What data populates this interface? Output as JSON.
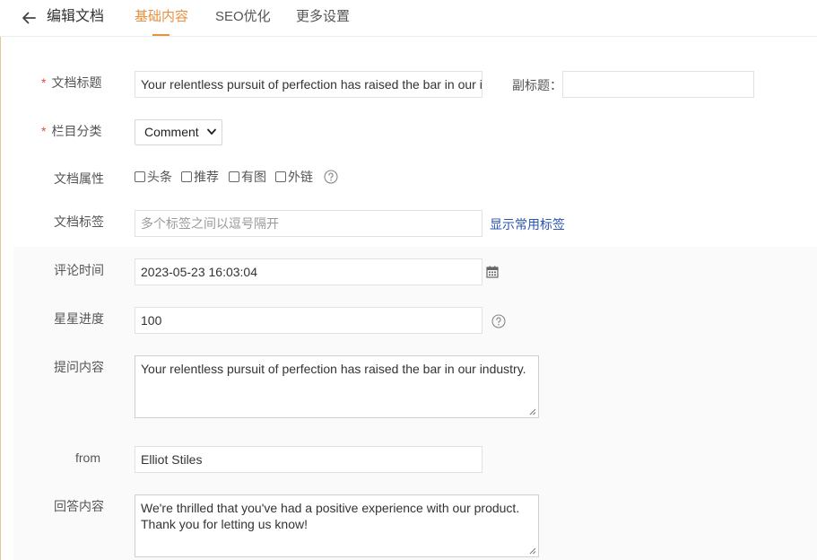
{
  "header": {
    "back_icon": "arrow-left-icon",
    "title": "编辑文档",
    "tabs": [
      {
        "label": "基础内容",
        "active": true
      },
      {
        "label": "SEO优化",
        "active": false
      },
      {
        "label": "更多设置",
        "active": false
      }
    ],
    "accent_color": "#e8913f"
  },
  "form": {
    "doc_title": {
      "label": "文档标题",
      "required": true,
      "value": "Your relentless pursuit of perfection has raised the bar in our industry."
    },
    "subtitle": {
      "label": "副标题：",
      "value": ""
    },
    "category": {
      "label": "栏目分类",
      "required": true,
      "selected": "Comment"
    },
    "attributes": {
      "label": "文档属性",
      "options": [
        {
          "label": "头条",
          "checked": false
        },
        {
          "label": "推荐",
          "checked": false
        },
        {
          "label": "有图",
          "checked": false
        },
        {
          "label": "外链",
          "checked": false
        }
      ]
    },
    "tags": {
      "label": "文档标签",
      "placeholder": "多个标签之间以逗号隔开",
      "value": "",
      "link": "显示常用标签"
    },
    "comment_time": {
      "label": "评论时间",
      "value": "2023-05-23 16:03:04"
    },
    "star_progress": {
      "label": "星星进度",
      "value": "100"
    },
    "question": {
      "label": "提问内容",
      "value": "Your relentless pursuit of perfection has raised the bar in our industry."
    },
    "from": {
      "label": "from",
      "value": "Elliot Stiles"
    },
    "answer": {
      "label": "回答内容",
      "value": "We're thrilled that you've had a positive experience with our product. Thank you for letting us know!"
    }
  }
}
